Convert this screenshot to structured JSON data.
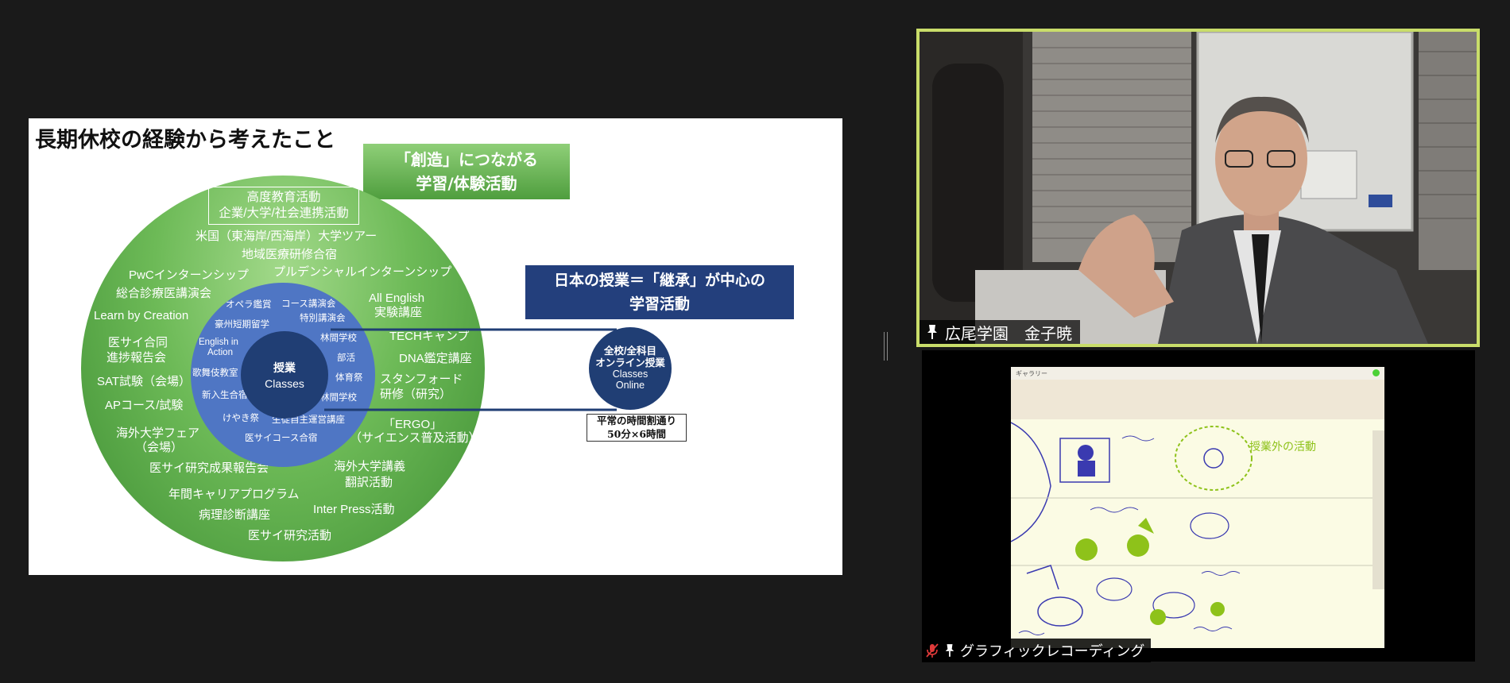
{
  "slide": {
    "title": "長期休校の経験から考えたこと",
    "green_banner": {
      "line1": "「創造」につながる",
      "line2": "学習/体験活動"
    },
    "advanced_box": {
      "line1": "高度教育活動",
      "line2": "企業/大学/社会連携活動"
    },
    "outer_items": [
      "米国（東海岸/西海岸）大学ツアー",
      "地域医療研修合宿",
      "PwCインターンシップ",
      "プルデンシャルインターンシップ",
      "総合診療医講演会",
      "Learn by Creation",
      "All English",
      "実験講座",
      "医サイ合同",
      "進捗報告会",
      "TECHキャンプ",
      "DNA鑑定講座",
      "SAT試験（会場）",
      "スタンフォード",
      "研修（研究）",
      "APコース/試験",
      "「ERGO」",
      "（サイエンス普及活動）",
      "海外大学フェア",
      "（会場）",
      "医サイ研究成果報告会",
      "海外大学講義",
      "翻訳活動",
      "年間キャリアプログラム",
      "Inter Press活動",
      "病理診断講座",
      "医サイ研究活動"
    ],
    "inner_items": [
      "オペラ鑑賞",
      "コース講演会",
      "特別講演会",
      "豪州短期留学",
      "English in",
      "Action",
      "林間学校",
      "部活",
      "歌舞伎教室",
      "体育祭",
      "新入生合宿",
      "林間学校",
      "けやき祭",
      "生徒自主運営講座",
      "医サイコース合宿"
    ],
    "core": {
      "jp": "授業",
      "en": "Classes"
    },
    "japan_banner": {
      "line1": "日本の授業＝「継承」が中心の",
      "line2": "学習活動"
    },
    "online": {
      "line1": "全校/全科目",
      "line2": "オンライン授業",
      "line3": "Classes",
      "line4": "Online"
    },
    "schedule": {
      "line1": "平常の時間割通り",
      "line2": "50分×6時間"
    }
  },
  "speaker": {
    "name": "広尾学園　金子暁"
  },
  "recorder": {
    "name": "グラフィックレコーディング",
    "toolbar_label": "ギャラリー",
    "sketch_note": "授業外の活動"
  },
  "colors": {
    "background": "#1a1a1a",
    "active_speaker_border": "#c9dd6a",
    "slide_green": "#6dba57",
    "slide_blue": "#4f76c4",
    "slide_navy": "#203e74",
    "mic_muted": "#e03a3a"
  },
  "icons": {
    "speaker_tag": "pin-icon",
    "recorder_tag_1": "mic-muted-icon",
    "recorder_tag_2": "pin-icon"
  }
}
